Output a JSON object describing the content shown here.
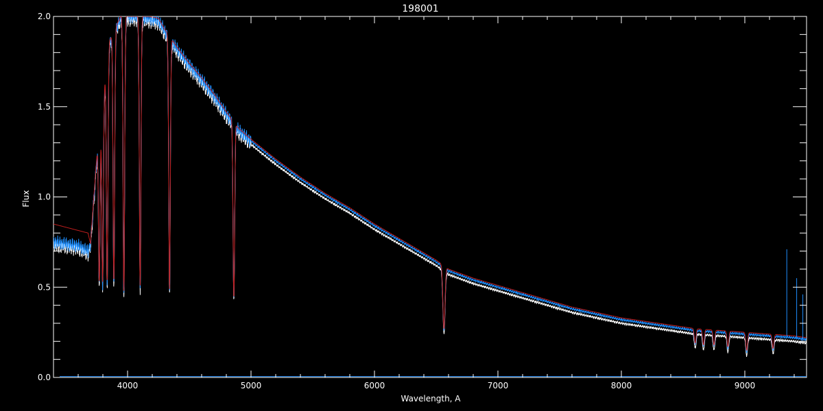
{
  "chart_data": {
    "type": "line",
    "title": "198001",
    "xlabel": "Wavelength, A",
    "ylabel": "Flux",
    "xlim": [
      3400,
      9500
    ],
    "ylim": [
      0.0,
      2.0
    ],
    "xticks": [
      4000,
      5000,
      6000,
      7000,
      8000,
      9000
    ],
    "xtick_labels": [
      "4000",
      "5000",
      "6000",
      "7000",
      "8000",
      "9000"
    ],
    "yticks": [
      0.0,
      0.5,
      1.0,
      1.5,
      2.0
    ],
    "ytick_labels": [
      "0.0",
      "0.5",
      "1.0",
      "1.5",
      "2.0"
    ],
    "grid": false,
    "colors": {
      "background": "#000000",
      "axes": "#ffffff",
      "white_series": "#ffffff",
      "blue_series": "#1e8fff",
      "red_series": "#c41e1e"
    },
    "continuum": [
      [
        3400,
        0.75
      ],
      [
        3600,
        0.73
      ],
      [
        3680,
        0.7
      ],
      [
        3700,
        0.74
      ],
      [
        3760,
        1.3
      ],
      [
        3850,
        1.85
      ],
      [
        3950,
        2.0
      ],
      [
        4100,
        2.0
      ],
      [
        4250,
        1.98
      ],
      [
        4300,
        1.92
      ],
      [
        4400,
        1.82
      ],
      [
        4500,
        1.73
      ],
      [
        4600,
        1.65
      ],
      [
        4700,
        1.56
      ],
      [
        4800,
        1.46
      ],
      [
        4900,
        1.37
      ],
      [
        5000,
        1.31
      ],
      [
        5200,
        1.2
      ],
      [
        5400,
        1.1
      ],
      [
        5600,
        1.01
      ],
      [
        5800,
        0.93
      ],
      [
        6000,
        0.84
      ],
      [
        6200,
        0.76
      ],
      [
        6400,
        0.68
      ],
      [
        6500,
        0.64
      ],
      [
        6600,
        0.59
      ],
      [
        6800,
        0.54
      ],
      [
        7000,
        0.5
      ],
      [
        7200,
        0.46
      ],
      [
        7400,
        0.42
      ],
      [
        7600,
        0.38
      ],
      [
        7800,
        0.35
      ],
      [
        8000,
        0.32
      ],
      [
        8200,
        0.3
      ],
      [
        8400,
        0.28
      ],
      [
        8600,
        0.26
      ],
      [
        8800,
        0.25
      ],
      [
        9000,
        0.24
      ],
      [
        9200,
        0.23
      ],
      [
        9400,
        0.22
      ],
      [
        9500,
        0.21
      ]
    ],
    "absorption_lines": [
      {
        "wavelength": 3771,
        "depth_to": 0.52
      },
      {
        "wavelength": 3798,
        "depth_to": 0.52
      },
      {
        "wavelength": 3835,
        "depth_to": 0.52
      },
      {
        "wavelength": 3889,
        "depth_to": 0.52
      },
      {
        "wavelength": 3970,
        "depth_to": 0.47
      },
      {
        "wavelength": 4102,
        "depth_to": 0.5
      },
      {
        "wavelength": 4340,
        "depth_to": 0.48
      },
      {
        "wavelength": 4861,
        "depth_to": 0.43
      },
      {
        "wavelength": 6563,
        "depth_to": 0.26
      },
      {
        "wavelength": 8598,
        "depth_to": 0.18
      },
      {
        "wavelength": 8665,
        "depth_to": 0.17
      },
      {
        "wavelength": 8750,
        "depth_to": 0.17
      },
      {
        "wavelength": 8863,
        "depth_to": 0.16
      },
      {
        "wavelength": 9015,
        "depth_to": 0.14
      },
      {
        "wavelength": 9229,
        "depth_to": 0.15
      }
    ],
    "series": [
      {
        "color": "#ffffff",
        "offset": -0.02
      },
      {
        "color": "#1e8fff",
        "offset": 0.0
      },
      {
        "color": "#c41e1e",
        "offset": 0.01,
        "blue_end_override": [
          [
            3400,
            0.85
          ],
          [
            3680,
            0.8
          ],
          [
            3700,
            0.74
          ]
        ]
      }
    ],
    "spikes": [
      {
        "wavelength": 9340,
        "value": 0.71
      },
      {
        "wavelength": 9420,
        "value": 0.55
      },
      {
        "wavelength": 9470,
        "value": 0.46
      }
    ]
  }
}
